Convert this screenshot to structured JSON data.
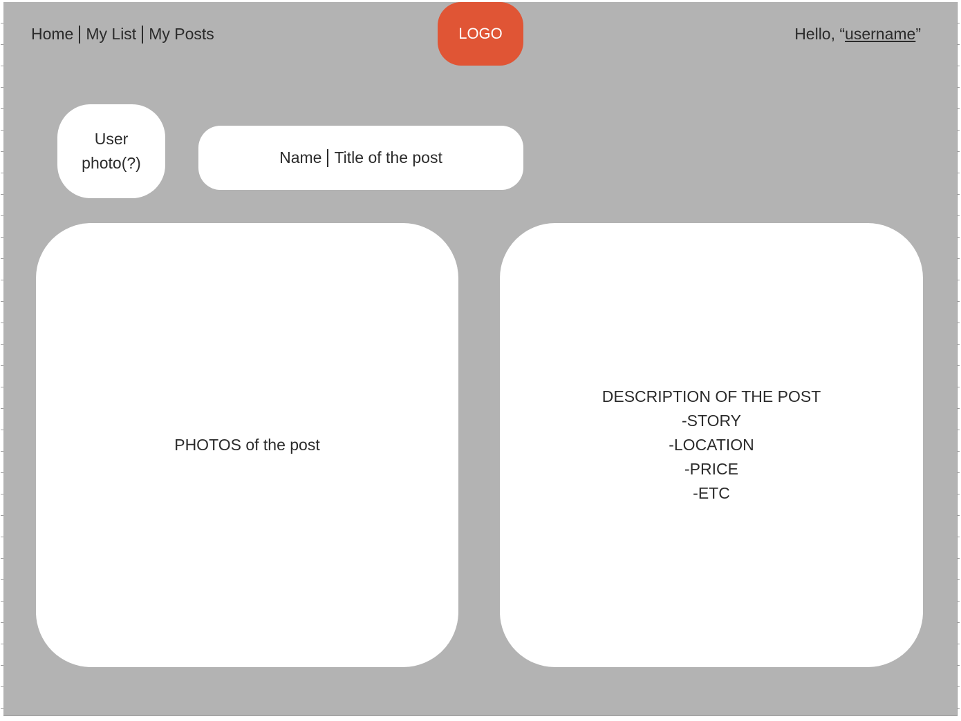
{
  "nav": {
    "items": [
      {
        "label": "Home"
      },
      {
        "label": "My List"
      },
      {
        "label": "My Posts"
      }
    ]
  },
  "logo": {
    "label": "LOGO"
  },
  "greeting": {
    "prefix": "Hello, “",
    "username": "username",
    "suffix": "”"
  },
  "user_photo": {
    "line1": "User",
    "line2": "photo(?)"
  },
  "post_header": {
    "name": "Name",
    "title": "Title of the post"
  },
  "photos": {
    "label": "PHOTOS of the post"
  },
  "description": {
    "heading": "DESCRIPTION OF THE POST",
    "items": [
      "-STORY",
      "-LOCATION",
      "-PRICE",
      "-ETC"
    ]
  },
  "colors": {
    "background": "#b3b3b3",
    "card": "#ffffff",
    "logo": "#e05535",
    "text": "#2b2b2b"
  }
}
